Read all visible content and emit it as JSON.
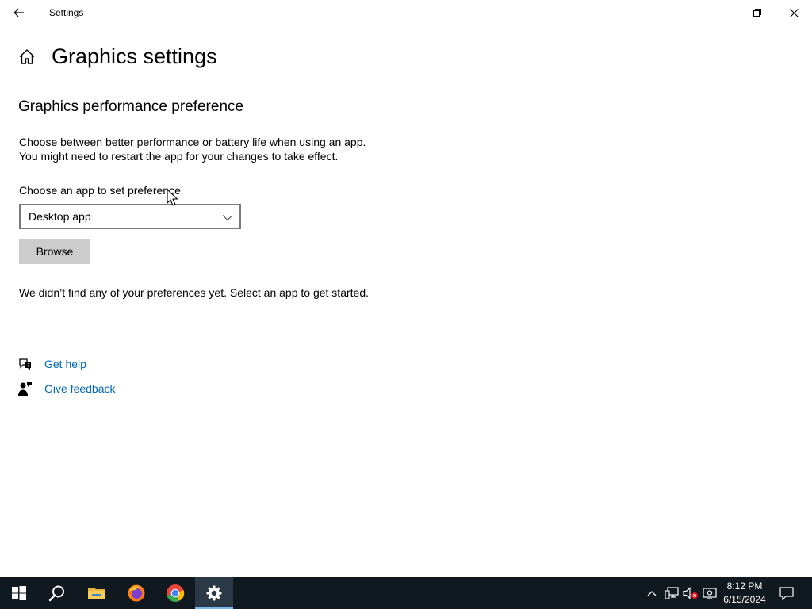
{
  "window": {
    "title": "Settings"
  },
  "page": {
    "title": "Graphics settings",
    "section_title": "Graphics performance preference",
    "description_line1": "Choose between better performance or battery life when using an app.",
    "description_line2": "You might need to restart the app for your changes to take effect.",
    "choose_label": "Choose an app to set preference",
    "dropdown": {
      "selected": "Desktop app"
    },
    "browse_label": "Browse",
    "empty_message": "We didn’t find any of your preferences yet. Select an app to get started."
  },
  "links": {
    "help": "Get help",
    "feedback": "Give feedback"
  },
  "taskbar": {
    "apps": [
      "start-icon",
      "search-icon",
      "file-explorer-icon",
      "firefox-icon",
      "chrome-icon",
      "settings-icon"
    ],
    "clock": {
      "time": "8:12 PM",
      "date": "6/15/2024"
    }
  },
  "colors": {
    "link": "#0067b8",
    "taskbar": "#101820",
    "button": "#cccccc"
  }
}
